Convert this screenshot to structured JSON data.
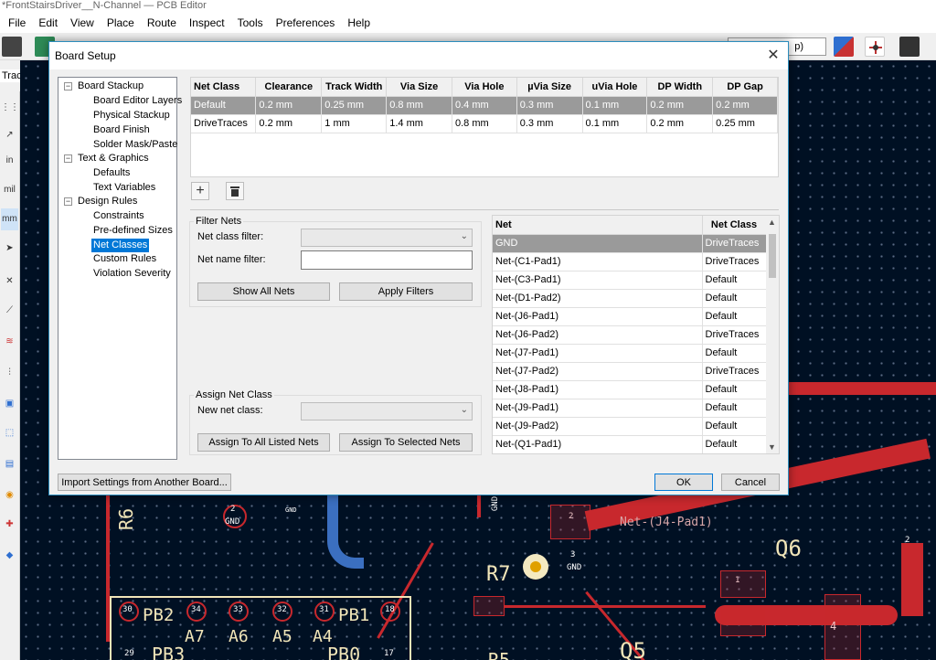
{
  "window": {
    "title": "*FrontStairsDriver__N-Channel — PCB Editor"
  },
  "menu": [
    "File",
    "Edit",
    "View",
    "Place",
    "Route",
    "Inspect",
    "Tools",
    "Preferences",
    "Help"
  ],
  "status_hint": "Track: use n",
  "toolbar_combo_text": "p)",
  "left_toolbar_labels": {
    "in": "in",
    "mil": "mil",
    "mm": "mm"
  },
  "dialog": {
    "title": "Board Setup",
    "tree": {
      "board_stackup": "Board Stackup",
      "board_editor_layers": "Board Editor Layers",
      "physical_stackup": "Physical Stackup",
      "board_finish": "Board Finish",
      "solder_mask_paste": "Solder Mask/Paste",
      "text_graphics": "Text & Graphics",
      "defaults": "Defaults",
      "text_variables": "Text Variables",
      "design_rules": "Design Rules",
      "constraints": "Constraints",
      "predefined_sizes": "Pre-defined Sizes",
      "net_classes": "Net Classes",
      "custom_rules": "Custom Rules",
      "violation_severity": "Violation Severity"
    },
    "netclass_columns": [
      "Net Class",
      "Clearance",
      "Track Width",
      "Via Size",
      "Via Hole",
      "µVia Size",
      "uVia Hole",
      "DP Width",
      "DP Gap"
    ],
    "netclass_rows": [
      [
        "Default",
        "0.2 mm",
        "0.25 mm",
        "0.8 mm",
        "0.4 mm",
        "0.3 mm",
        "0.1 mm",
        "0.2 mm",
        "0.2 mm"
      ],
      [
        "DriveTraces",
        "0.2 mm",
        "1 mm",
        "1.4 mm",
        "0.8 mm",
        "0.3 mm",
        "0.1 mm",
        "0.2 mm",
        "0.25 mm"
      ]
    ],
    "filter": {
      "title": "Filter Nets",
      "net_class_filter_label": "Net class filter:",
      "net_name_filter_label": "Net name filter:",
      "net_name_filter_value": "",
      "show_all_nets": "Show All Nets",
      "apply_filters": "Apply Filters"
    },
    "assign": {
      "title": "Assign Net Class",
      "new_net_class_label": "New net class:",
      "assign_all": "Assign To All Listed Nets",
      "assign_selected": "Assign To Selected Nets"
    },
    "nets_columns": [
      "Net",
      "Net Class"
    ],
    "nets": [
      [
        "GND",
        "DriveTraces"
      ],
      [
        "Net-(C1-Pad1)",
        "DriveTraces"
      ],
      [
        "Net-(C3-Pad1)",
        "Default"
      ],
      [
        "Net-(D1-Pad2)",
        "Default"
      ],
      [
        "Net-(J6-Pad1)",
        "Default"
      ],
      [
        "Net-(J6-Pad2)",
        "DriveTraces"
      ],
      [
        "Net-(J7-Pad1)",
        "Default"
      ],
      [
        "Net-(J7-Pad2)",
        "DriveTraces"
      ],
      [
        "Net-(J8-Pad1)",
        "Default"
      ],
      [
        "Net-(J9-Pad1)",
        "Default"
      ],
      [
        "Net-(J9-Pad2)",
        "Default"
      ],
      [
        "Net-(Q1-Pad1)",
        "Default"
      ]
    ],
    "import_button": "Import Settings from Another Board...",
    "ok_button": "OK",
    "cancel_button": "Cancel"
  },
  "pcb": {
    "labels": {
      "r6": "R6",
      "r7": "R7",
      "q6": "Q6",
      "q5": "Q5",
      "r5": "R5",
      "pb2": "PB2",
      "pb1": "PB1",
      "pb3": "PB3",
      "pb0": "PB0",
      "a7": "A7",
      "a6": "A6",
      "a5": "A5",
      "a4": "A4",
      "gnd1": "GND",
      "gnd2": "GND",
      "gnd3": "GND",
      "gnd_v": "GND",
      "net_j4": "Net-(J4-Pad1)",
      "pin2a": "2",
      "pin2b": "2",
      "pin3": "3",
      "pin2c": "2",
      "pin4": "4",
      "pin1": "1",
      "pin30": "30",
      "pin34": "34",
      "pin33": "33",
      "pin32": "32",
      "pin31": "31",
      "pin18": "18",
      "pin29": "29",
      "pin17": "17"
    }
  }
}
